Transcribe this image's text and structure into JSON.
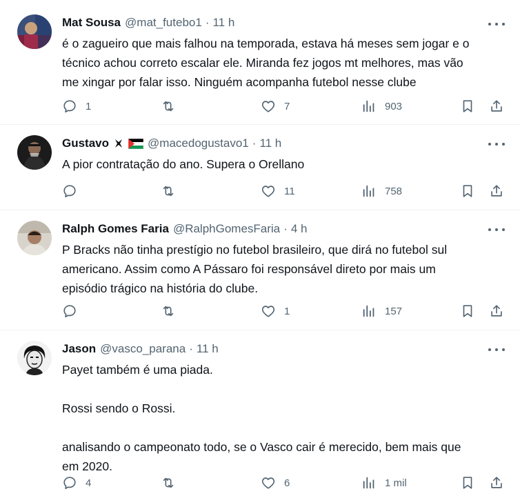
{
  "tweets": [
    {
      "name": "Mat Sousa",
      "handle": "@mat_futebo1",
      "time": "11 h",
      "text": "é o zagueiro que mais falhou na temporada, estava há meses sem jogar e o\ntécnico achou correto escalar ele. Miranda fez jogos mt melhores, mas vão\nme xingar por falar isso. Ninguém acompanha futebol nesse clube",
      "replies": "1",
      "retweets": "",
      "likes": "7",
      "views": "903"
    },
    {
      "name": "Gustavo",
      "badges": [
        "cross-pattee-icon",
        "palestine-flag-icon"
      ],
      "handle": "@macedogustavo1",
      "time": "11 h",
      "text": "A pior contratação do ano. Supera o Orellano",
      "replies": "",
      "retweets": "",
      "likes": "11",
      "views": "758"
    },
    {
      "name": "Ralph Gomes Faria",
      "handle": "@RalphGomesFaria",
      "time": "4 h",
      "text": "P Bracks não tinha prestígio no futebol brasileiro, que dirá no futebol sul\namericano. Assim como A Pássaro foi responsável direto por mais um\nepisódio trágico na história do clube.",
      "replies": "",
      "retweets": "",
      "likes": "1",
      "views": "157"
    },
    {
      "name": "Jason",
      "handle": "@vasco_parana",
      "time": "11 h",
      "text": "Payet também é uma piada.\n\nRossi sendo o Rossi.\n\nanalisando o campeonato todo, se o Vasco cair é merecido, bem mais que\nem 2020.",
      "replies": "4",
      "retweets": "",
      "likes": "6",
      "views": "1 mil"
    }
  ],
  "separator": "·",
  "colors": {
    "text": "#0f1419",
    "secondary": "#536471",
    "border": "#eff3f4"
  }
}
